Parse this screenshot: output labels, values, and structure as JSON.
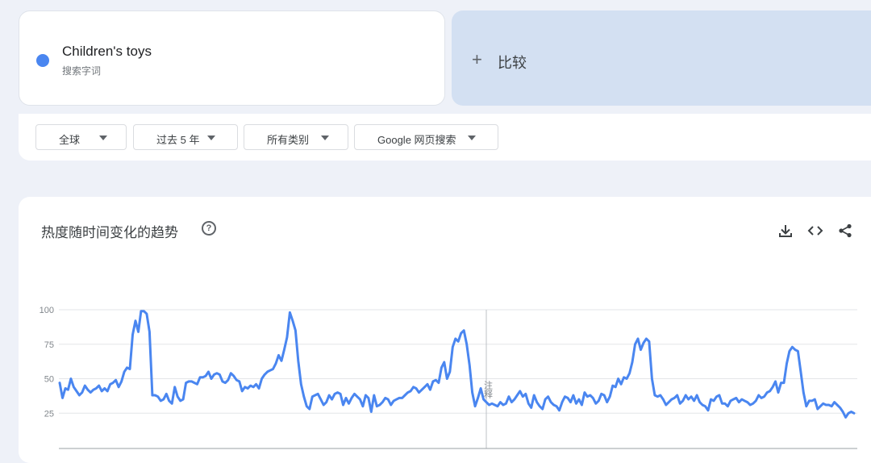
{
  "search_term": {
    "title": "Children's toys",
    "subtitle": "搜索字词",
    "color": "#4a86f0"
  },
  "compare": {
    "plus": "+",
    "label": "比较"
  },
  "filters": {
    "region": "全球",
    "time_range": "过去 5 年",
    "category": "所有类别",
    "search_type": "Google 网页搜索"
  },
  "chart_panel": {
    "title": "热度随时间变化的趋势",
    "help": "?",
    "annotation": "注释",
    "icons": [
      "download-icon",
      "embed-code-icon",
      "share-icon"
    ]
  },
  "chart_data": {
    "type": "line",
    "series": [
      {
        "color": "#4a86f0",
        "values": [
          47,
          36,
          43,
          42,
          50,
          44,
          41,
          38,
          40,
          45,
          42,
          40,
          42,
          43,
          45,
          41,
          43,
          41,
          46,
          47,
          49,
          44,
          48,
          55,
          58,
          57,
          82,
          92,
          84,
          99,
          99,
          97,
          84,
          38,
          38,
          37,
          34,
          35,
          39,
          34,
          32,
          44,
          37,
          34,
          35,
          47,
          48,
          48,
          47,
          46,
          51,
          51,
          52,
          55,
          50,
          53,
          54,
          53,
          48,
          47,
          49,
          54,
          52,
          49,
          48,
          41,
          44,
          43,
          45,
          44,
          46,
          43,
          50,
          53,
          55,
          56,
          57,
          61,
          67,
          63,
          71,
          80,
          98,
          92,
          85,
          63,
          46,
          37,
          30,
          28,
          37,
          38,
          39,
          35,
          31,
          33,
          38,
          35,
          39,
          40,
          39,
          31,
          36,
          32,
          36,
          39,
          37,
          35,
          30,
          38,
          36,
          26,
          38,
          30,
          31,
          33,
          36,
          35,
          31,
          34,
          35,
          36,
          36,
          38,
          40,
          41,
          44,
          43,
          40,
          42,
          44,
          46,
          42,
          48,
          49,
          47,
          58,
          62,
          50,
          55,
          73,
          79,
          77,
          83,
          85,
          75,
          60,
          40,
          30,
          36,
          43,
          35,
          33,
          31,
          32,
          31,
          30,
          33,
          31,
          32,
          37,
          33,
          35,
          38,
          41,
          37,
          39,
          32,
          29,
          38,
          33,
          30,
          28,
          35,
          37,
          33,
          31,
          30,
          27,
          33,
          37,
          36,
          33,
          38,
          32,
          35,
          31,
          40,
          37,
          38,
          36,
          32,
          34,
          39,
          38,
          33,
          37,
          45,
          44,
          50,
          46,
          51,
          50,
          54,
          62,
          75,
          79,
          71,
          76,
          79,
          77,
          50,
          38,
          37,
          38,
          35,
          31,
          33,
          35,
          36,
          38,
          32,
          34,
          38,
          35,
          37,
          34,
          38,
          33,
          31,
          30,
          27,
          35,
          34,
          37,
          38,
          32,
          32,
          30,
          34,
          35,
          36,
          33,
          35,
          34,
          33,
          31,
          32,
          34,
          38,
          36,
          37,
          40,
          41,
          44,
          48,
          40,
          47,
          47,
          61,
          70,
          73,
          71,
          70,
          55,
          40,
          30,
          34,
          34,
          35,
          28,
          30,
          32,
          31,
          31,
          30,
          33,
          31,
          29,
          26,
          22,
          25,
          26,
          25
        ]
      }
    ],
    "y_ticks": [
      100,
      75,
      50,
      25
    ],
    "ylim": [
      0,
      100
    ],
    "grid": true
  }
}
